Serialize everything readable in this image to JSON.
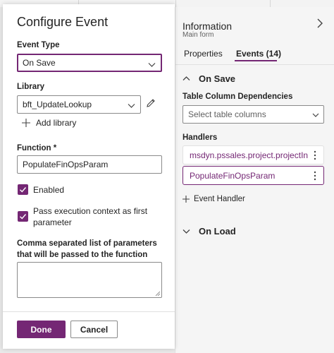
{
  "colors": {
    "accent": "#742774",
    "panel_bg": "#f5f5f5"
  },
  "dialog": {
    "title": "Configure Event",
    "event_type": {
      "label": "Event Type",
      "value": "On Save"
    },
    "library": {
      "label": "Library",
      "value": "bft_UpdateLookup",
      "add_label": "Add library"
    },
    "function": {
      "label": "Function *",
      "value": "PopulateFinOpsParam"
    },
    "enabled": {
      "label": "Enabled",
      "checked": true
    },
    "pass_context": {
      "label_line1": "Pass execution context as first",
      "label_line2": "parameter",
      "checked": true
    },
    "params": {
      "label_line1": "Comma separated list of parameters",
      "label_line2": "that will be passed to the function",
      "value": ""
    },
    "done_label": "Done",
    "cancel_label": "Cancel"
  },
  "panel": {
    "title": "Information",
    "subtitle": "Main form",
    "tabs": [
      {
        "label": "Properties",
        "active": false
      },
      {
        "label": "Events (14)",
        "active": true
      }
    ],
    "on_save": {
      "label": "On Save",
      "dependencies_label": "Table Column Dependencies",
      "dependencies_placeholder": "Select table columns",
      "handlers_label": "Handlers",
      "handlers": [
        {
          "name": "msdyn.pssales.project.projectIn",
          "selected": false
        },
        {
          "name": "PopulateFinOpsParam",
          "selected": true
        }
      ],
      "add_handler_label": "Event Handler"
    },
    "on_load": {
      "label": "On Load"
    }
  },
  "icons": [
    "chevron-down-icon",
    "chevron-up-icon",
    "chevron-right-icon",
    "pencil-icon",
    "plus-icon",
    "checkmark-icon",
    "more-vertical-icon",
    "resize-grip-icon"
  ]
}
